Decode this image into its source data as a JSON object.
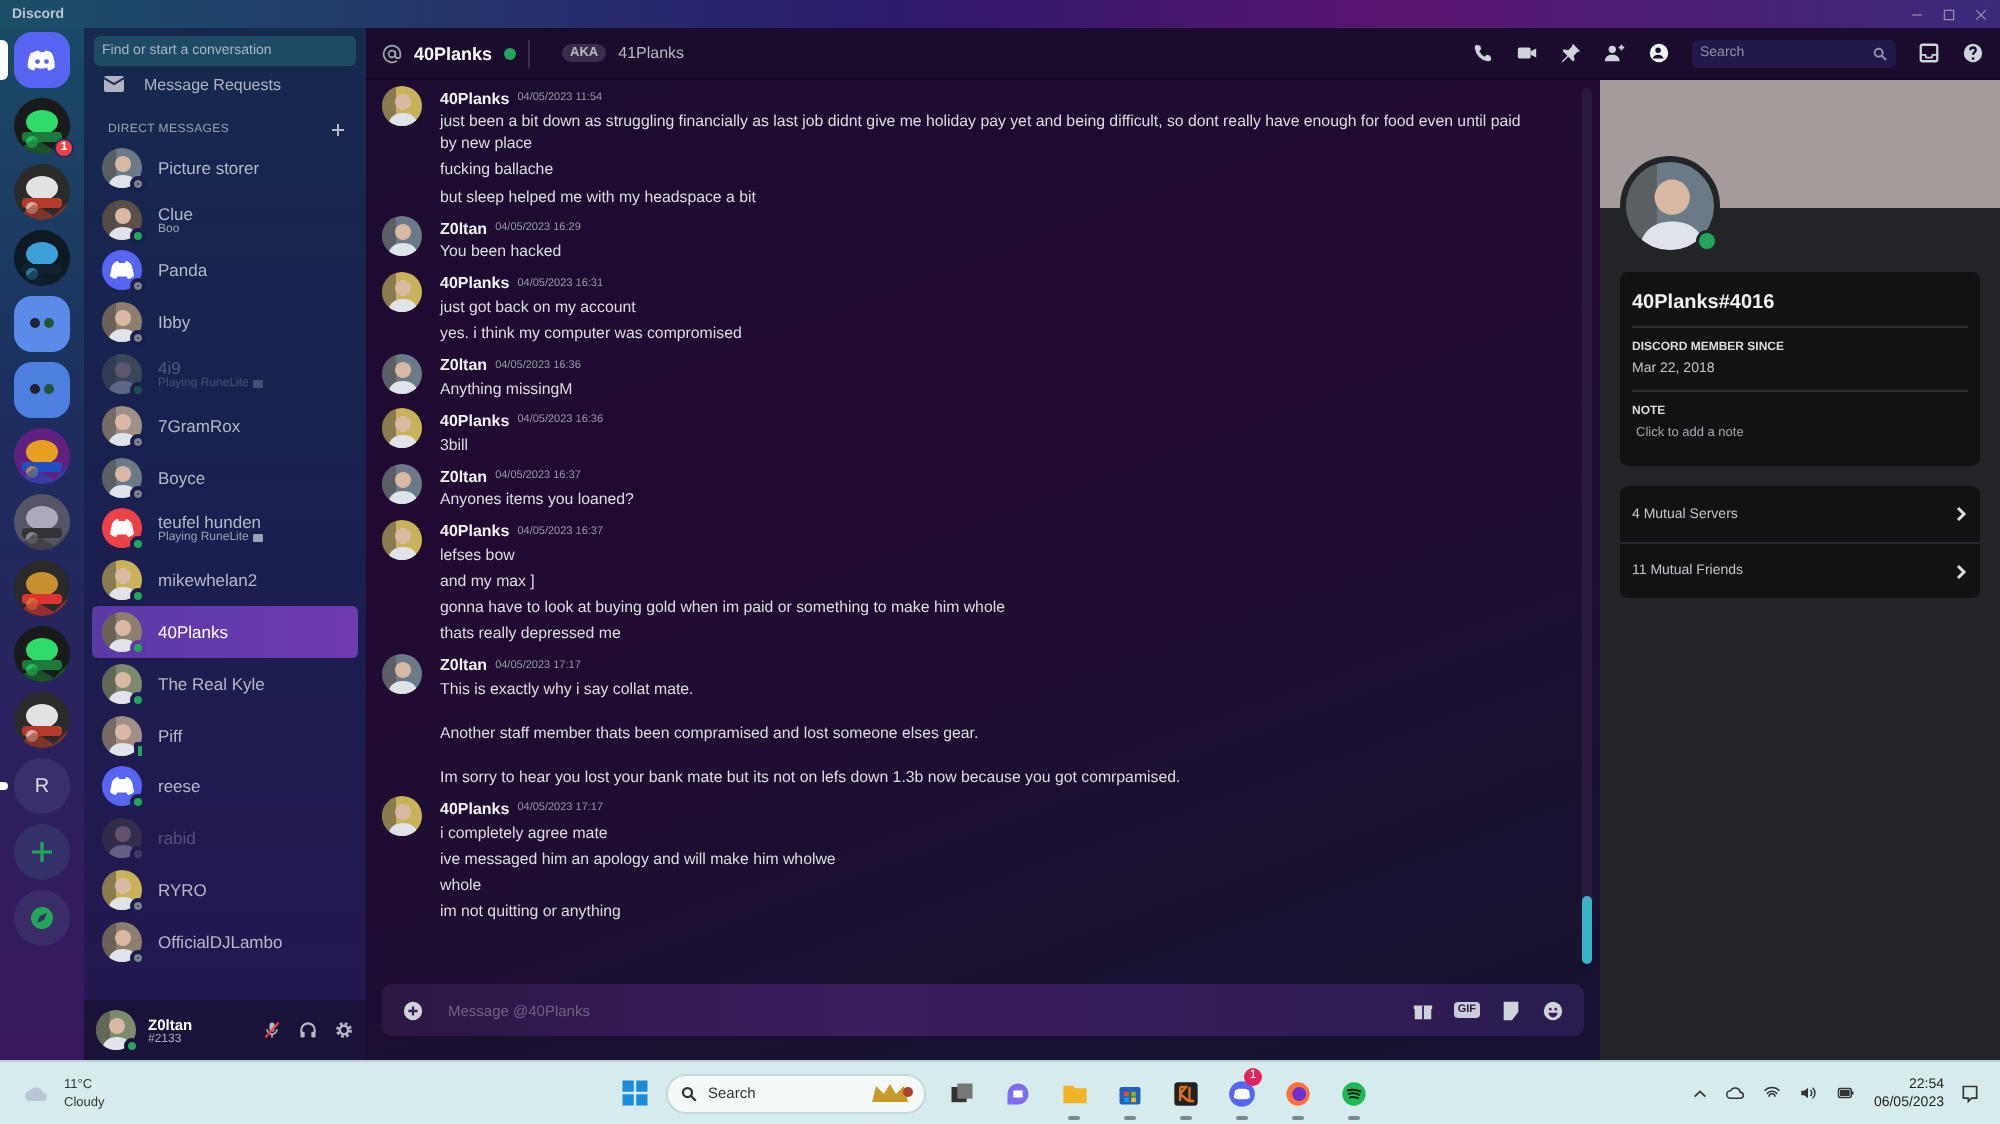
{
  "titlebar": {
    "title": "Discord"
  },
  "servers": [
    {
      "kind": "home",
      "selected": true,
      "unread": false
    },
    {
      "kind": "picture",
      "selected": false,
      "unread": false,
      "badge": "1"
    },
    {
      "kind": "picture",
      "selected": false,
      "unread": false
    },
    {
      "kind": "picture",
      "selected": false,
      "unread": false
    },
    {
      "kind": "folder",
      "selected": false,
      "unread": false
    },
    {
      "kind": "folder",
      "selected": false,
      "unread": false
    },
    {
      "kind": "picture",
      "selected": false,
      "unread": false
    },
    {
      "kind": "picture",
      "selected": false,
      "unread": false
    },
    {
      "kind": "picture",
      "selected": false,
      "unread": false
    },
    {
      "kind": "picture",
      "selected": false,
      "unread": false
    },
    {
      "kind": "picture",
      "selected": false,
      "unread": false
    },
    {
      "kind": "letter",
      "label": "R",
      "selected": false,
      "unread": true
    },
    {
      "kind": "add",
      "selected": false,
      "unread": false
    },
    {
      "kind": "explore",
      "selected": false,
      "unread": false
    }
  ],
  "dm_sidebar": {
    "search_placeholder": "Find or start a conversation",
    "requests_label": "Message Requests",
    "section_title": "DIRECT MESSAGES",
    "items": [
      {
        "name": "Picture storer",
        "online": false,
        "mobile": false,
        "dimmed": false,
        "selected": false
      },
      {
        "name": "Clue",
        "subtitle": "Boo",
        "activity": false,
        "online": true,
        "mobile": false,
        "dimmed": false,
        "selected": false
      },
      {
        "kind": "default",
        "name": "Panda",
        "color": "#5865f2",
        "online": false,
        "mobile": false,
        "dimmed": false,
        "selected": false
      },
      {
        "name": "Ibby",
        "online": false,
        "mobile": false,
        "dimmed": false,
        "selected": false
      },
      {
        "name": "4i9",
        "subtitle": "Playing RuneLite",
        "activity": true,
        "online": true,
        "mobile": false,
        "dimmed": true,
        "selected": false
      },
      {
        "name": "7GramRox",
        "online": false,
        "mobile": false,
        "dimmed": false,
        "selected": false
      },
      {
        "name": "Boyce",
        "online": false,
        "mobile": false,
        "dimmed": false,
        "selected": false
      },
      {
        "kind": "default",
        "name": "teufel hunden",
        "color": "#ed4245",
        "subtitle": "Playing RuneLite",
        "activity": true,
        "online": true,
        "mobile": false,
        "dimmed": false,
        "selected": false
      },
      {
        "name": "mikewhelan2",
        "online": true,
        "mobile": false,
        "dimmed": false,
        "selected": false
      },
      {
        "name": "40Planks",
        "online": true,
        "mobile": false,
        "dimmed": false,
        "selected": true
      },
      {
        "name": "The Real Kyle",
        "online": true,
        "mobile": false,
        "dimmed": false,
        "selected": false
      },
      {
        "name": "Piff",
        "online": true,
        "mobile": true,
        "dimmed": false,
        "selected": false
      },
      {
        "kind": "default",
        "name": "reese",
        "color": "#5865f2",
        "online": true,
        "mobile": false,
        "dimmed": false,
        "selected": false
      },
      {
        "name": "rabid",
        "online": false,
        "mobile": false,
        "dimmed": true,
        "selected": false
      },
      {
        "name": "RYRO",
        "online": false,
        "mobile": false,
        "dimmed": false,
        "selected": false
      },
      {
        "name": "OfficialDJLambo",
        "online": false,
        "mobile": false,
        "dimmed": false,
        "selected": false
      }
    ]
  },
  "user_panel": {
    "name": "Z0ltan",
    "tag": "#2133",
    "online": true,
    "muted": true
  },
  "chat": {
    "header": {
      "name": "40Planks",
      "online": true,
      "aka_label": "AKA",
      "aka_name": "41Planks",
      "search_placeholder": "Search"
    },
    "messages": [
      {
        "kind": "lines",
        "author": "40Planks",
        "time": "04/05/2023 11:54",
        "lines": [
          "just been a bit down as struggling financially as last job didnt give me holiday pay yet and being difficult, so dont really have enough for food even until paid by new place",
          "fucking ballache",
          "but sleep helped me with my headspace a bit"
        ]
      },
      {
        "kind": "lines",
        "author": "Z0ltan",
        "time": "04/05/2023 16:29",
        "lines": [
          "You been hacked"
        ]
      },
      {
        "kind": "lines",
        "author": "40Planks",
        "time": "04/05/2023 16:31",
        "lines": [
          "just got back on my account",
          "yes. i think my computer was compromised"
        ]
      },
      {
        "kind": "lines",
        "author": "Z0ltan",
        "time": "04/05/2023 16:36",
        "lines": [
          "Anything missingM"
        ]
      },
      {
        "kind": "lines",
        "author": "40Planks",
        "time": "04/05/2023 16:36",
        "lines": [
          "3bill"
        ]
      },
      {
        "kind": "lines",
        "author": "Z0ltan",
        "time": "04/05/2023 16:37",
        "lines": [
          "Anyones items you loaned?"
        ]
      },
      {
        "kind": "lines",
        "author": "40Planks",
        "time": "04/05/2023 16:37",
        "lines": [
          "lefses bow",
          "and my max ]",
          "gonna have to look at buying gold when im paid or something to make him whole",
          "thats really depressed me"
        ]
      },
      {
        "kind": "paragraphs",
        "author": "Z0ltan",
        "time": "04/05/2023 17:17",
        "lines": [
          "This is exactly why i say collat mate.",
          "Another staff member thats been compramised and lost someone elses gear.",
          "Im sorry to hear you lost your bank mate but its not on lefs down 1.3b now because you got comrpamised."
        ]
      },
      {
        "kind": "lines",
        "author": "40Planks",
        "time": "04/05/2023 17:17",
        "lines": [
          "i completely agree mate",
          "ive messaged him an apology and will make him wholwe",
          "whole",
          "im not quitting or anything"
        ]
      }
    ],
    "composer": {
      "placeholder": "Message @40Planks",
      "gif_label": "GIF"
    }
  },
  "profile": {
    "online": true,
    "handle": "40Planks#4016",
    "member_since_title": "DISCORD MEMBER SINCE",
    "member_since": "Mar 22, 2018",
    "note_title": "NOTE",
    "note_placeholder": "Click to add a note",
    "mutuals": [
      "4 Mutual Servers",
      "11 Mutual Friends"
    ]
  },
  "taskbar": {
    "temperature": "11°C",
    "weather": "Cloudy",
    "search_placeholder": "Search",
    "time": "22:54",
    "date": "06/05/2023",
    "apps": [
      {
        "kind": "taskview",
        "running": false
      },
      {
        "kind": "chat",
        "running": false
      },
      {
        "kind": "explorer",
        "running": true
      },
      {
        "kind": "store",
        "running": true
      },
      {
        "kind": "runelite",
        "running": true
      },
      {
        "kind": "discord",
        "running": true,
        "badge": "1"
      },
      {
        "kind": "firefox",
        "running": true
      },
      {
        "kind": "spotify",
        "running": true
      }
    ]
  }
}
